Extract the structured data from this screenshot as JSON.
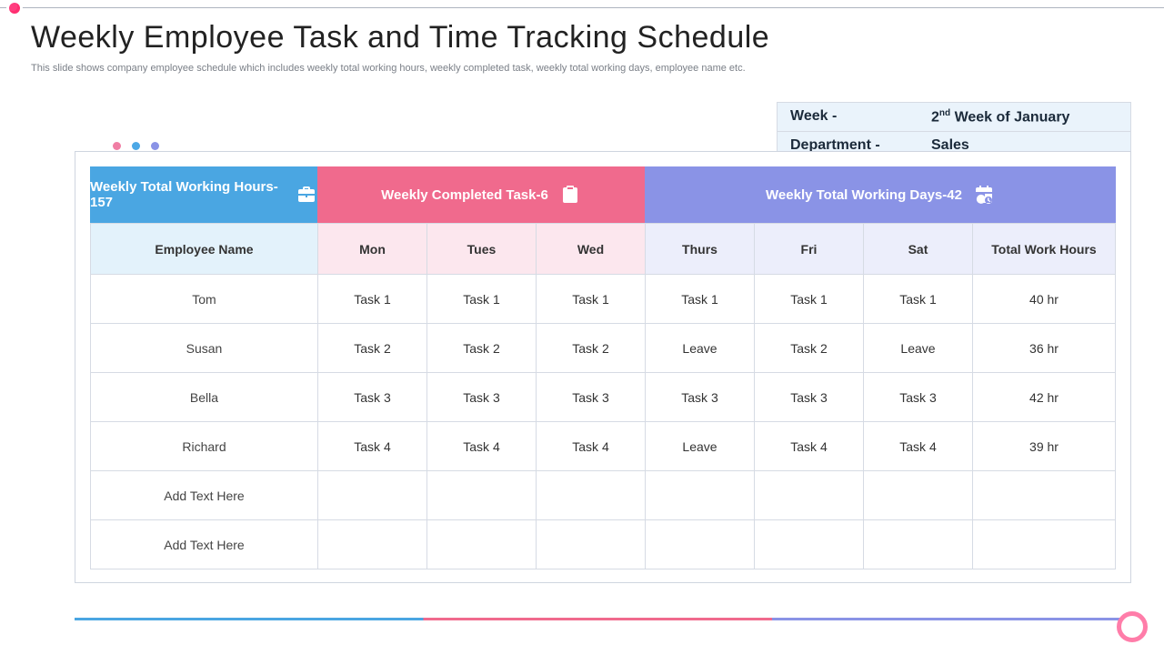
{
  "title": "Weekly Employee Task and Time Tracking Schedule",
  "subtitle": "This slide shows company employee schedule which includes weekly total working hours, weekly completed task, weekly total working days, employee name etc.",
  "meta": {
    "week_label": "Week -",
    "week_value_prefix": "2",
    "week_value_ord": "nd",
    "week_value_suffix": " Week of January",
    "dept_label": "Department -",
    "dept_value": "Sales"
  },
  "summary": {
    "hours": "Weekly Total Working Hours-157",
    "tasks": "Weekly Completed Task-6",
    "days": "Weekly Total Working Days-42"
  },
  "columns": {
    "name": "Employee Name",
    "mon": "Mon",
    "tue": "Tues",
    "wed": "Wed",
    "thu": "Thurs",
    "fri": "Fri",
    "sat": "Sat",
    "total": "Total Work Hours"
  },
  "rows": [
    {
      "name": "Tom",
      "mon": "Task 1",
      "tue": "Task 1",
      "wed": "Task 1",
      "thu": "Task 1",
      "fri": "Task 1",
      "sat": "Task 1",
      "total": "40 hr"
    },
    {
      "name": "Susan",
      "mon": "Task 2",
      "tue": "Task 2",
      "wed": "Task 2",
      "thu": "Leave",
      "fri": "Task 2",
      "sat": "Leave",
      "total": "36 hr"
    },
    {
      "name": "Bella",
      "mon": "Task 3",
      "tue": "Task 3",
      "wed": "Task 3",
      "thu": "Task 3",
      "fri": "Task 3",
      "sat": "Task 3",
      "total": "42 hr"
    },
    {
      "name": "Richard",
      "mon": "Task 4",
      "tue": "Task 4",
      "wed": "Task 4",
      "thu": "Leave",
      "fri": "Task 4",
      "sat": "Task 4",
      "total": "39 hr"
    },
    {
      "name": "Add Text Here",
      "mon": "",
      "tue": "",
      "wed": "",
      "thu": "",
      "fri": "",
      "sat": "",
      "total": ""
    },
    {
      "name": "Add Text Here",
      "mon": "",
      "tue": "",
      "wed": "",
      "thu": "",
      "fri": "",
      "sat": "",
      "total": ""
    }
  ],
  "chart_data": {
    "type": "table",
    "title": "Weekly Employee Task and Time Tracking Schedule",
    "week": "2nd Week of January",
    "department": "Sales",
    "totals": {
      "weekly_total_working_hours": 157,
      "weekly_completed_tasks": 6,
      "weekly_total_working_days": 42
    },
    "columns": [
      "Employee Name",
      "Mon",
      "Tues",
      "Wed",
      "Thurs",
      "Fri",
      "Sat",
      "Total Work Hours"
    ],
    "rows": [
      [
        "Tom",
        "Task 1",
        "Task 1",
        "Task 1",
        "Task 1",
        "Task 1",
        "Task 1",
        "40 hr"
      ],
      [
        "Susan",
        "Task 2",
        "Task 2",
        "Task 2",
        "Leave",
        "Task 2",
        "Leave",
        "36 hr"
      ],
      [
        "Bella",
        "Task 3",
        "Task 3",
        "Task 3",
        "Task 3",
        "Task 3",
        "Task 3",
        "42 hr"
      ],
      [
        "Richard",
        "Task 4",
        "Task 4",
        "Task 4",
        "Leave",
        "Task 4",
        "Task 4",
        "39 hr"
      ]
    ]
  }
}
